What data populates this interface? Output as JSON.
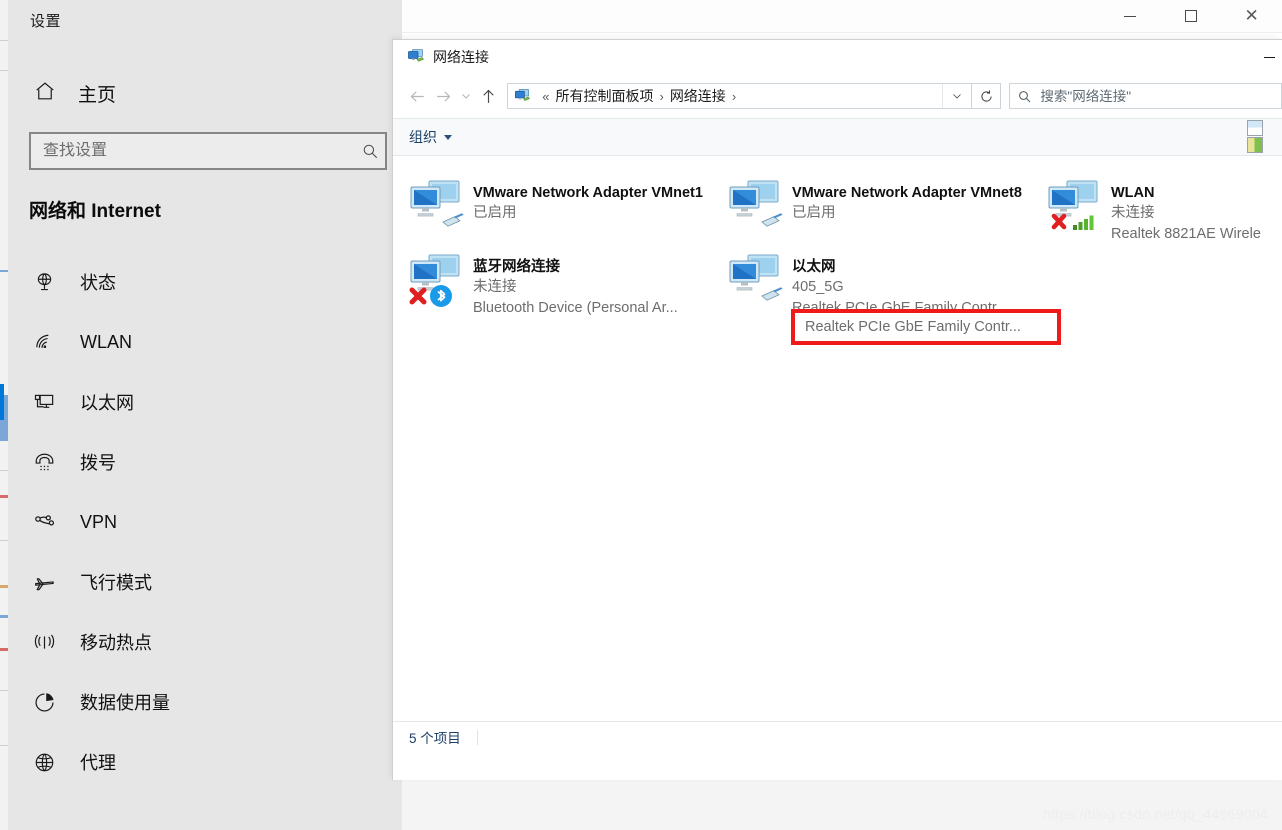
{
  "settings": {
    "title": "设置",
    "home": {
      "label": "主页",
      "icon": "home-icon"
    },
    "search": {
      "placeholder": "查找设置",
      "value": "",
      "icon": "search-icon"
    },
    "section_heading": "网络和 Internet",
    "nav_items": [
      {
        "label": "状态",
        "icon": "globe-status-icon",
        "selected": false
      },
      {
        "label": "WLAN",
        "icon": "wifi-icon",
        "selected": false
      },
      {
        "label": "以太网",
        "icon": "ethernet-icon",
        "selected": true
      },
      {
        "label": "拨号",
        "icon": "dialup-phone-icon",
        "selected": false
      },
      {
        "label": "VPN",
        "icon": "vpn-icon",
        "selected": false
      },
      {
        "label": "飞行模式",
        "icon": "airplane-icon",
        "selected": false
      },
      {
        "label": "移动热点",
        "icon": "hotspot-icon",
        "selected": false
      },
      {
        "label": "数据使用量",
        "icon": "pie-chart-icon",
        "selected": false
      },
      {
        "label": "代理",
        "icon": "globe-icon",
        "selected": false
      }
    ]
  },
  "window_controls": {
    "minimize": "minimize-icon",
    "maximize": "maximize-icon",
    "close": "close-icon",
    "close_glyph": "✕"
  },
  "explorer": {
    "title": "网络连接",
    "title_icon": "network-connections-icon",
    "minimize_label": "minimize-icon",
    "nav": {
      "back": "back-arrow-icon",
      "forward": "forward-arrow-icon",
      "recent": "chevron-down-icon",
      "up": "up-arrow-icon",
      "refresh": "refresh-icon",
      "address_dropdown": "chevron-down-icon"
    },
    "address": {
      "icon": "network-connections-icon",
      "prefix": "«",
      "crumbs": [
        "所有控制面板项",
        "网络连接"
      ],
      "separator": "›"
    },
    "search": {
      "placeholder": "搜索\"网络连接\"",
      "value": "",
      "icon": "search-icon"
    },
    "toolbar": {
      "organize_label": "组织",
      "caret": "caret-down-icon",
      "view_toggle_details": "details-view-icon",
      "view_toggle_preview": "preview-pane-icon"
    },
    "connections": [
      {
        "name": "VMware Network Adapter VMnet1",
        "status": "已启用",
        "device": "",
        "icon": "network-adapter-icon",
        "badge": "none"
      },
      {
        "name": "VMware Network Adapter VMnet8",
        "status": "已启用",
        "device": "",
        "icon": "network-adapter-icon",
        "badge": "none"
      },
      {
        "name": "WLAN",
        "status": "未连接",
        "device": "Realtek 8821AE Wirele",
        "icon": "network-adapter-icon",
        "badge": "red-x-signal-bars"
      },
      {
        "name": "蓝牙网络连接",
        "status": "未连接",
        "device": "Bluetooth Device (Personal Ar...",
        "icon": "network-adapter-icon",
        "badge": "red-x-bluetooth"
      },
      {
        "name": "以太网",
        "status": "405_5G",
        "device": "Realtek PCIe GbE Family Contr...",
        "icon": "network-adapter-icon",
        "badge": "none"
      }
    ],
    "highlight": {
      "text": "Realtek PCIe GbE Family Contr...",
      "color": "#ef1b1b"
    },
    "statusbar": {
      "item_count": "5 个项目"
    }
  },
  "watermark": {
    "text": "https://blog.csdn.net/qq_44969004"
  },
  "colors": {
    "accent": "#0078d7",
    "settings_bg": "#e6e6e6",
    "explorer_bg": "#ffffff",
    "toolbar_bg": "#f7f9fa",
    "toolbar_text": "#1b3f66",
    "muted_text": "#6d6d6d",
    "highlight_red": "#ef1b1b"
  }
}
